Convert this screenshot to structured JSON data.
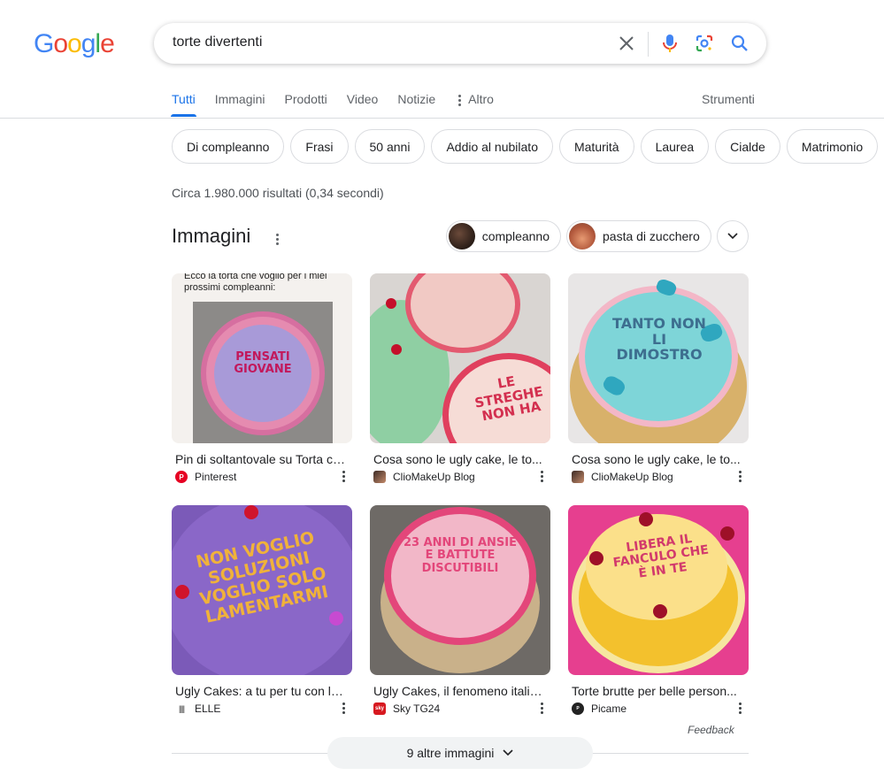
{
  "logo": {
    "text": "Google"
  },
  "search": {
    "query": "torte divertenti"
  },
  "tabs": [
    {
      "label": "Tutti",
      "active": true
    },
    {
      "label": "Immagini"
    },
    {
      "label": "Prodotti"
    },
    {
      "label": "Video"
    },
    {
      "label": "Notizie"
    },
    {
      "label": "Altro"
    }
  ],
  "tools_label": "Strumenti",
  "chips": [
    "Di compleanno",
    "Frasi",
    "50 anni",
    "Addio al nubilato",
    "Maturità",
    "Laurea",
    "Cialde",
    "Matrimonio"
  ],
  "stats": "Circa 1.980.000 risultati (0,34 secondi)",
  "images_section": {
    "title": "Immagini",
    "filters": [
      "compleanno",
      "pasta di zucchero"
    ],
    "cards": [
      {
        "caption": "Pin di soltantovale su Torta co...",
        "source": "Pinterest",
        "cake_text": "PENSATI GIOVANE",
        "top_text": "Ecco la torta che voglio per i miei prossimi compleanni:"
      },
      {
        "caption": "Cosa sono le ugly cake, le to...",
        "source": "ClioMakeUp Blog",
        "cake_text": "LE STREGHE NON HA"
      },
      {
        "caption": "Cosa sono le ugly cake, le to...",
        "source": "ClioMakeUp Blog",
        "cake_text": "TANTO NON LI DIMOSTRO"
      },
      {
        "caption": "Ugly Cakes: a tu per tu con la ...",
        "source": "ELLE",
        "cake_text": "NON VOGLIO SOLUZIONI VOGLIO SOLO LAMENTARMI"
      },
      {
        "caption": "Ugly Cakes, il fenomeno italia...",
        "source": "Sky TG24",
        "cake_text": "23 ANNI DI ANSIE E BATTUTE DISCUTIBILI"
      },
      {
        "caption": "Torte brutte per belle person...",
        "source": "Picame",
        "cake_text": "LIBERA IL FANCULO CHE È IN TE"
      }
    ],
    "feedback": "Feedback",
    "more_button": "9 altre immagini"
  },
  "colors": {
    "accent": "#1a73e8",
    "text": "#202124",
    "muted": "#5f6368"
  }
}
